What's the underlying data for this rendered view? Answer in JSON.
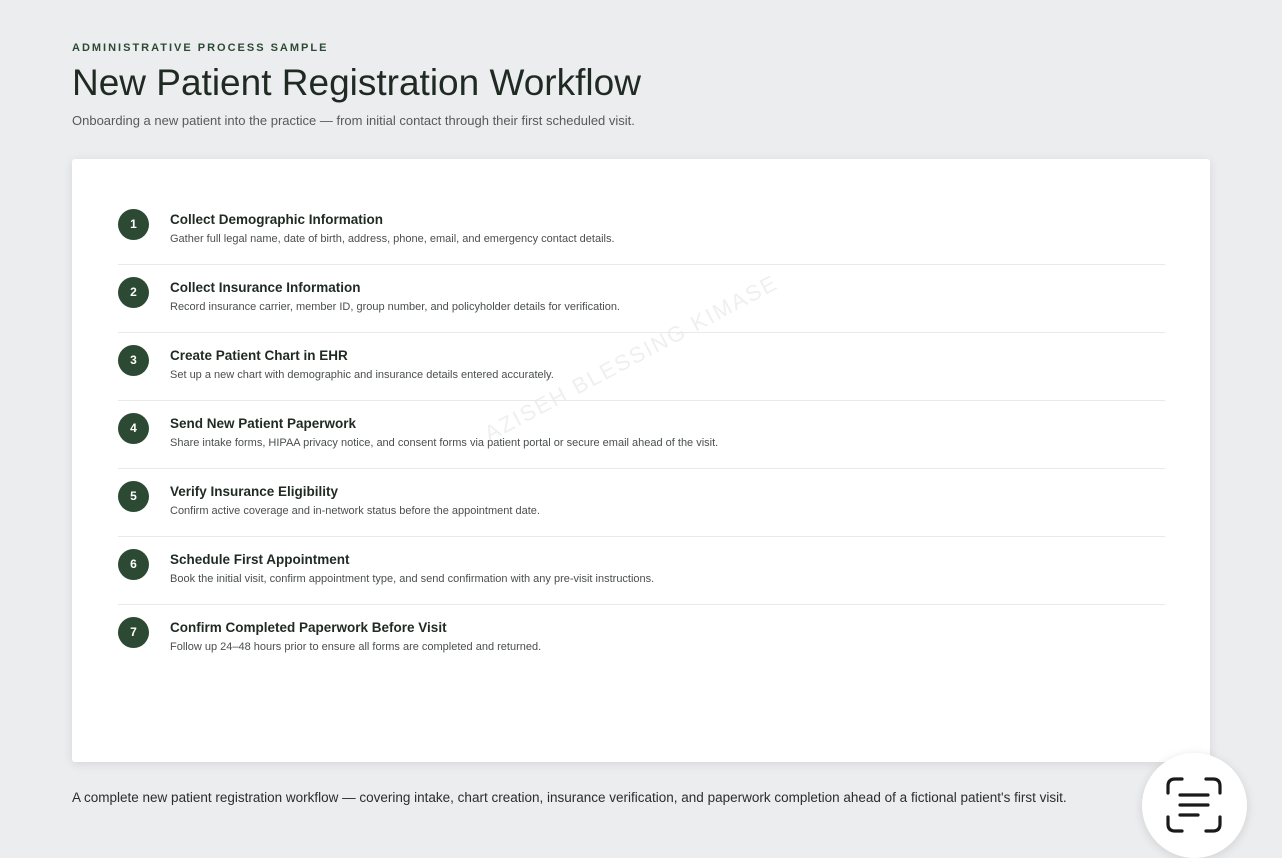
{
  "header": {
    "eyebrow": "ADMINISTRATIVE PROCESS SAMPLE",
    "title": "New Patient Registration Workflow",
    "subtitle": "Onboarding a new patient into the practice — from initial contact through their first scheduled visit."
  },
  "steps": [
    {
      "number": "1",
      "title": "Collect Demographic Information",
      "description": "Gather full legal name, date of birth, address, phone, email, and emergency contact details."
    },
    {
      "number": "2",
      "title": "Collect Insurance Information",
      "description": "Record insurance carrier, member ID, group number, and policyholder details for verification."
    },
    {
      "number": "3",
      "title": "Create Patient Chart in EHR",
      "description": "Set up a new chart with demographic and insurance details entered accurately."
    },
    {
      "number": "4",
      "title": "Send New Patient Paperwork",
      "description": "Share intake forms, HIPAA privacy notice, and consent forms via patient portal or secure email ahead of the visit."
    },
    {
      "number": "5",
      "title": "Verify Insurance Eligibility",
      "description": "Confirm active coverage and in-network status before the appointment date."
    },
    {
      "number": "6",
      "title": "Schedule First Appointment",
      "description": "Book the initial visit, confirm appointment type, and send confirmation with any pre-visit instructions."
    },
    {
      "number": "7",
      "title": "Confirm Completed Paperwork Before Visit",
      "description": "Follow up 24–48 hours prior to ensure all forms are completed and returned."
    }
  ],
  "watermark": "AZISEH BLESSING KIMASE",
  "caption": "A complete new patient registration workflow — covering intake, chart creation, insurance verification, and paperwork completion ahead of a fictional patient's first visit.",
  "fab": {
    "icon": "text-scan-icon"
  },
  "colors": {
    "accent": "#2c4a33",
    "background": "#ecedef",
    "card": "#ffffff"
  }
}
